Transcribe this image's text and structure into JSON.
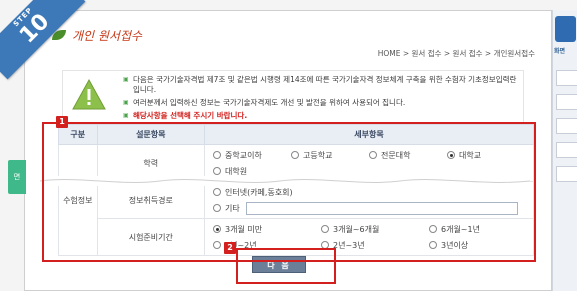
{
  "step": {
    "label": "STEP",
    "number": "10"
  },
  "header": {
    "title": "개인 원서접수"
  },
  "breadcrumb": "HOME > 원서 접수 > 원서 접수 > 개인원서접수",
  "notice": {
    "items": [
      "다음은 국가기술자격법 제7조 및 같은법 시행령 제14조에 따른 국가기술자격 정보체계 구축을 위한 수험자 기초정보입력란입니다.",
      "여러분께서 입력하신 정보는 국가기술자격제도 개선 및 발전을 위하여 사용되어 집니다.",
      "해당사항을 선택해 주시기 바랍니다."
    ]
  },
  "markers": {
    "m1": "1",
    "m2": "2"
  },
  "left_tab": "면",
  "table": {
    "headers": [
      "구분",
      "설문항목",
      "세부항목"
    ],
    "category": "수험정보",
    "rows": [
      {
        "item": "학력",
        "options": [
          "중학교이하",
          "고등학교",
          "전문대학",
          "대학교",
          "대학원"
        ],
        "selected": "대학교"
      },
      {
        "item": "정보취득경로",
        "options": [
          "인터넷(카페,동호회)",
          "기타"
        ],
        "selected": ""
      },
      {
        "item": "시험준비기간",
        "options": [
          "3개월 미만",
          "3개월~6개월",
          "6개월~1년",
          "1년~2년",
          "2년~3년",
          "3년이상"
        ],
        "selected": "3개월 미만"
      }
    ]
  },
  "buttons": {
    "next": "다 음"
  },
  "right_panel": {
    "label": "화면"
  }
}
